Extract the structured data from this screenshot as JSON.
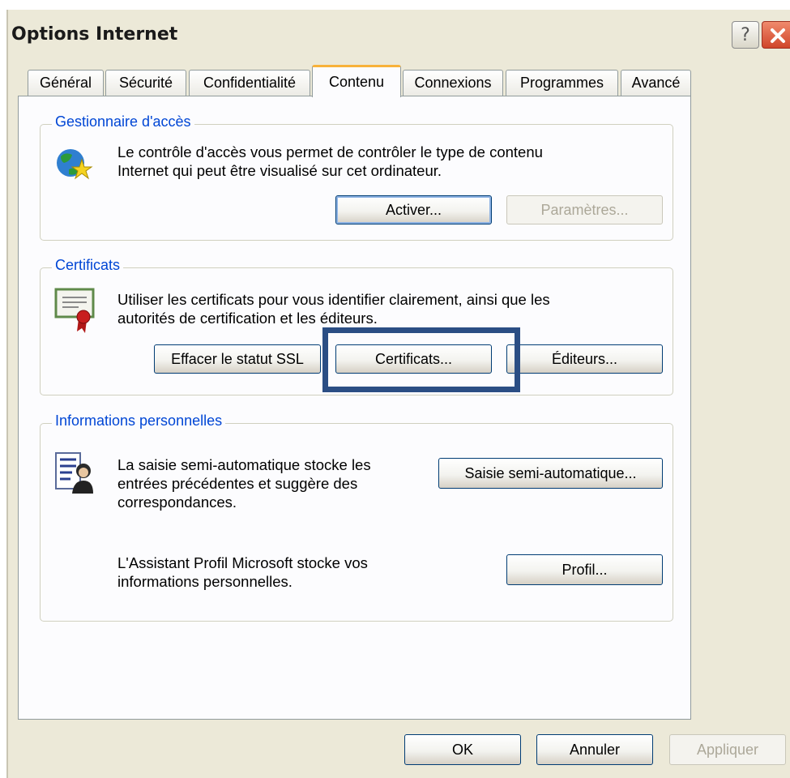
{
  "window": {
    "title": "Options Internet"
  },
  "tabs": [
    {
      "label": "Général",
      "active": false
    },
    {
      "label": "Sécurité",
      "active": false
    },
    {
      "label": "Confidentialité",
      "active": false
    },
    {
      "label": "Contenu",
      "active": true
    },
    {
      "label": "Connexions",
      "active": false
    },
    {
      "label": "Programmes",
      "active": false
    },
    {
      "label": "Avancé",
      "active": false
    }
  ],
  "access_manager": {
    "legend": "Gestionnaire d'accès",
    "line1": "Le contrôle d'accès vous permet de contrôler le type de contenu",
    "line2": "Internet qui peut être visualisé sur cet ordinateur.",
    "enable_button": "Activer...",
    "settings_button": "Paramètres..."
  },
  "certificates": {
    "legend": "Certificats",
    "line1": "Utiliser les certificats pour vous identifier clairement, ainsi que les",
    "line2": "autorités de certification et les éditeurs.",
    "clear_ssl_button": "Effacer le statut SSL",
    "certificates_button": "Certificats...",
    "publishers_button": "Éditeurs..."
  },
  "personal_info": {
    "legend": "Informations personnelles",
    "autocomplete_line1": "La saisie semi-automatique stocke les",
    "autocomplete_line2": "entrées précédentes et suggère des",
    "autocomplete_line3": "correspondances.",
    "autocomplete_button": "Saisie semi-automatique...",
    "profile_line1": "L'Assistant Profil Microsoft stocke vos",
    "profile_line2": "informations personnelles.",
    "profile_button": "Profil..."
  },
  "footer": {
    "ok": "OK",
    "cancel": "Annuler",
    "apply": "Appliquer"
  },
  "colors": {
    "dialog_bg": "#ECE9D8",
    "legend_text": "#0046D5",
    "active_tab_accent": "#F8B23A",
    "highlight_frame": "#2B4E84"
  }
}
